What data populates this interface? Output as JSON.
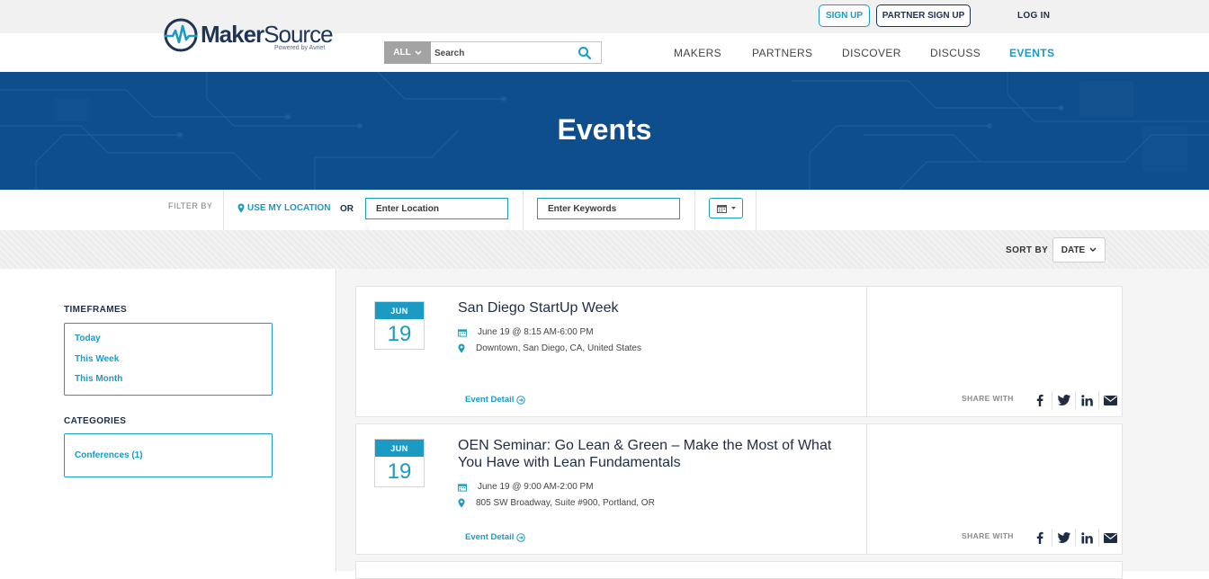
{
  "topbar": {
    "signup_label": "SIGN UP",
    "partner_signup_label": "PARTNER SIGN UP",
    "login_label": "LOG IN"
  },
  "logo": {
    "name_bold": "Maker",
    "name_regular": "Source",
    "tagline": "Powered by Avnet"
  },
  "search": {
    "scope_label": "ALL",
    "placeholder": "Search"
  },
  "nav": {
    "items": [
      {
        "label": "MAKERS"
      },
      {
        "label": "PARTNERS"
      },
      {
        "label": "DISCOVER"
      },
      {
        "label": "DISCUSS"
      },
      {
        "label": "EVENTS",
        "active": true
      }
    ]
  },
  "hero": {
    "title": "Events"
  },
  "filter": {
    "label": "FILTER BY",
    "use_location_label": "USE MY LOCATION",
    "or_label": "OR",
    "location_placeholder": "Enter Location",
    "keywords_placeholder": "Enter Keywords"
  },
  "sort": {
    "label": "SORT BY",
    "selected": "DATE"
  },
  "sidebar": {
    "timeframes_heading": "TIMEFRAMES",
    "timeframes": [
      "Today",
      "This Week",
      "This Month"
    ],
    "categories_heading": "CATEGORIES",
    "categories": [
      "Conferences (1)"
    ]
  },
  "events": [
    {
      "month": "JUN",
      "day": "19",
      "title": "San Diego StartUp Week",
      "time": "June 19 @ 8:15 AM-6:00 PM",
      "location": "Downtown, San Diego, CA, United States",
      "detail_label": "Event Detail",
      "share_label": "SHARE WITH"
    },
    {
      "month": "JUN",
      "day": "19",
      "title": "OEN Seminar: Go Lean & Green – Make the Most of What You Have with Lean Fundamentals",
      "time": "June 19 @ 9:00 AM-2:00 PM",
      "location": "805 SW Broadway, Suite #900, Portland, OR",
      "detail_label": "Event Detail",
      "share_label": "SHARE WITH"
    }
  ],
  "colors": {
    "accent": "#1b9ac4",
    "navy": "#1e2d44",
    "hero": "#0f4e8c"
  }
}
